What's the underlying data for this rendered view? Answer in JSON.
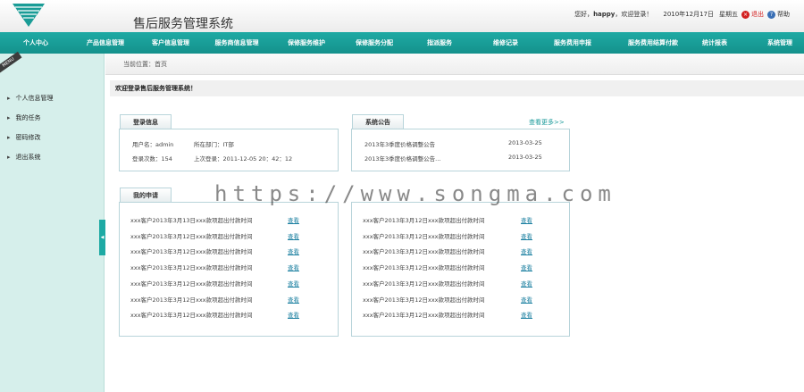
{
  "header": {
    "title": "售后服务管理系统",
    "greeting_prefix": "您好，",
    "username": "happy",
    "greeting_suffix": "，欢迎登录！",
    "date": "2010年12月17日",
    "weekday": "星期五",
    "logout": "退出",
    "help": "帮助"
  },
  "nav": {
    "items": [
      "个人中心",
      "产品信息管理",
      "客户信息管理",
      "服务商信息管理",
      "保修服务维护",
      "保修服务分配",
      "指派服务",
      "维修记录",
      "服务费用申报",
      "服务费用结算付款",
      "统计报表",
      "系统管理"
    ]
  },
  "sidebar": {
    "tag": "MENU",
    "items": [
      "个人信息管理",
      "我的任务",
      "密码修改",
      "退出系统"
    ]
  },
  "breadcrumb": "当前位置：首页",
  "welcome": "欢迎登录售后服务管理系统！",
  "login_info": {
    "tab": "登录信息",
    "username_label": "用户名：admin",
    "dept_label": "所在部门：IT部",
    "count_label": "登录次数：154",
    "last_label": "上次登录：2011-12-05 20：42：12"
  },
  "notice": {
    "tab": "系统公告",
    "more": "查看更多>>",
    "rows": [
      {
        "title": "2013年3季度价格调整公告",
        "date": "2013-03-25"
      },
      {
        "title": "2013年3季度价格调整公告...",
        "date": "2013-03-25"
      }
    ]
  },
  "requests": {
    "tab": "我的申请",
    "view_label": "查看",
    "left": [
      "xxx客户2013年3月13日xxx款项超出付款时间",
      "xxx客户2013年3月12日xxx款项超出付款时间",
      "xxx客户2013年3月12日xxx款项超出付款时间",
      "xxx客户2013年3月12日xxx款项超出付款时间",
      "xxx客户2013年3月12日xxx款项超出付款时间",
      "xxx客户2013年3月12日xxx款项超出付款时间",
      "xxx客户2013年3月12日xxx款项超出付款时间"
    ],
    "right": [
      "xxx客户2013年3月12日xxx款项超出付款时间",
      "xxx客户2013年3月12日xxx款项超出付款时间",
      "xxx客户2013年3月12日xxx款项超出付款时间",
      "xxx客户2013年3月12日xxx款项超出付款时间",
      "xxx客户2013年3月12日xxx款项超出付款时间",
      "xxx客户2013年3月12日xxx款项超出付款时间",
      "xxx客户2013年3月12日xxx款项超出付款时间"
    ]
  },
  "watermark": "https://www.songma.com",
  "colors": {
    "accent": "#1eaaa4",
    "sidebar": "#d6efeb",
    "link": "#1a7fa0"
  }
}
